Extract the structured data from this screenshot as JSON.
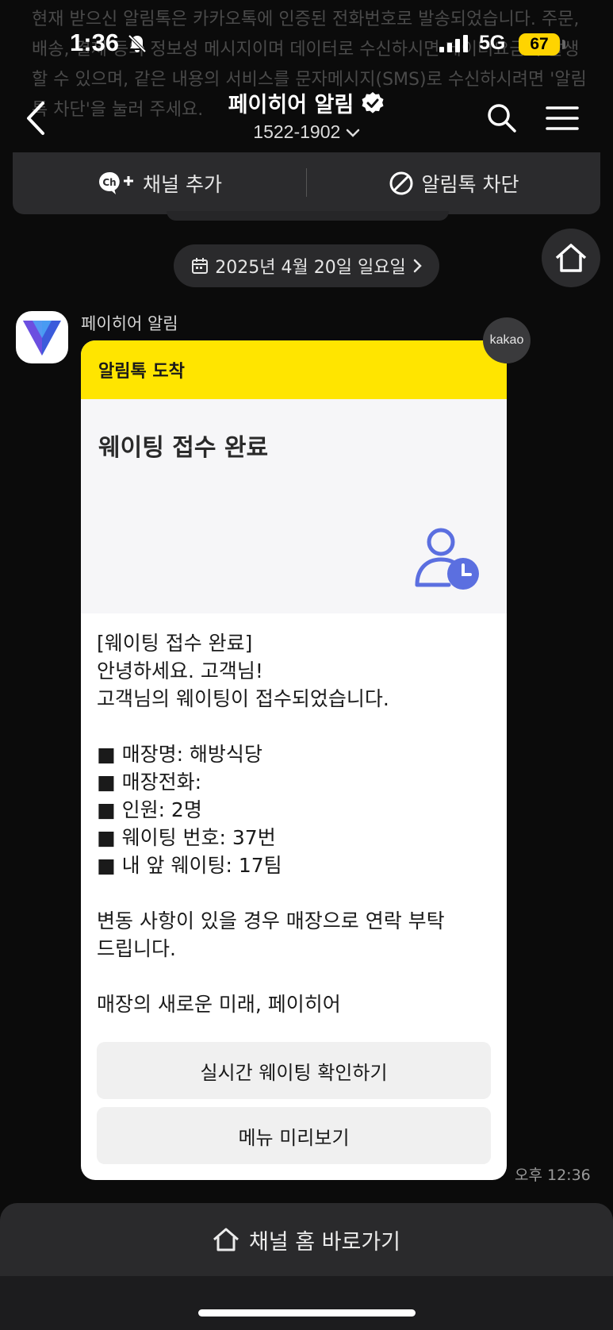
{
  "background_notice": "현재 받으신 알림톡은 카카오톡에 인증된 전화번호로 발송되었습니다. 주문, 배송, 결제 등의 정보성 메시지이며 데이터로 수신하시면 데이터요금이 발생할 수 있으며, 같은 내용의 서비스를 문자메시지(SMS)로 수신하시려면 '알림톡 차단'을 눌러 주세요.",
  "status_bar": {
    "time": "1:36",
    "network": "5G",
    "battery": "67"
  },
  "header": {
    "title": "페이히어 알림",
    "phone": "1522-1902"
  },
  "action_bar": {
    "add_channel": "채널 추가",
    "block": "알림톡 차단"
  },
  "date_pill": "2025년 4월 20일 일요일",
  "message": {
    "sender": "페이히어 알림",
    "badge": "kakao",
    "card_header": "알림톡 도착",
    "hero_title": "웨이팅 접수 완료",
    "lines": [
      "[웨이팅 접수 완료]",
      "안녕하세요. 고객님!",
      "고객님의 웨이팅이 접수되었습니다.",
      "",
      "■ 매장명: 해방식당",
      "■ 매장전화:",
      "■ 인원: 2명",
      "■ 웨이팅 번호: 37번",
      "■ 내 앞 웨이팅: 17팀",
      "",
      "변동 사항이 있을 경우 매장으로 연락 부탁",
      "드립니다.",
      "",
      "매장의 새로운 미래, 페이히어"
    ],
    "buttons": [
      "실시간 웨이팅 확인하기",
      "메뉴 미리보기"
    ],
    "timestamp": "오후 12:36"
  },
  "bottom_bar": {
    "label": "채널 홈 바로가기"
  },
  "colors": {
    "accent_yellow": "#ffe500",
    "background": "#0b0b0b",
    "icon_blue": "#5b6fe0"
  }
}
